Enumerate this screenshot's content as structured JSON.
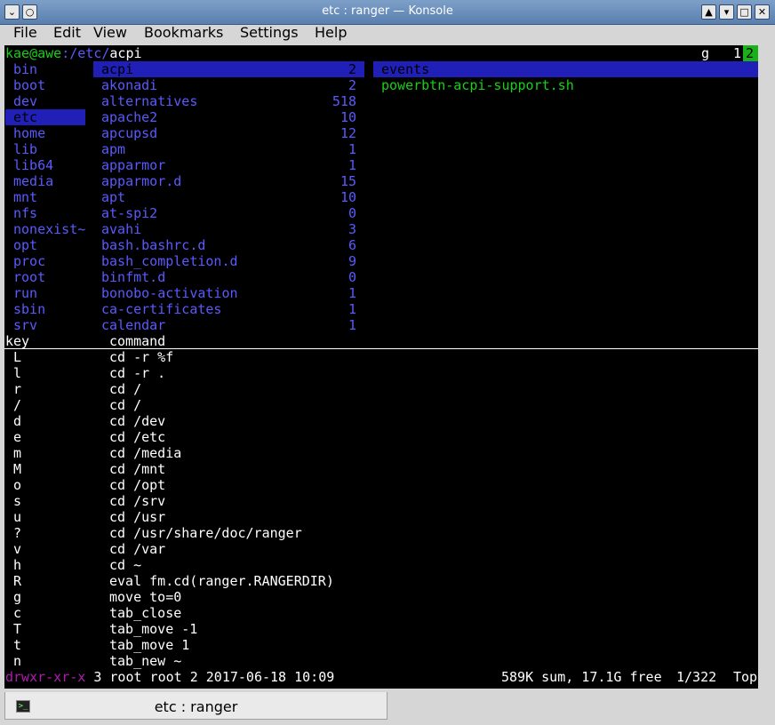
{
  "window": {
    "title": "etc : ranger — Konsole"
  },
  "menu": [
    "File",
    "Edit",
    "View",
    "Bookmarks",
    "Settings",
    "Help"
  ],
  "prompt": {
    "user_host": "kae@awe",
    "path": ":/etc/",
    "current": "acpi"
  },
  "tabs_indicator": {
    "key": "g",
    "tab1": "1",
    "tab2": "2"
  },
  "column_left": [
    "bin",
    "boot",
    "dev",
    "etc",
    "home",
    "lib",
    "lib64",
    "media",
    "mnt",
    "nfs",
    "nonexist~",
    "opt",
    "proc",
    "root",
    "run",
    "sbin",
    "srv"
  ],
  "column_mid": [
    {
      "name": "acpi",
      "count": "2"
    },
    {
      "name": "akonadi",
      "count": "2"
    },
    {
      "name": "alternatives",
      "count": "518"
    },
    {
      "name": "apache2",
      "count": "10"
    },
    {
      "name": "apcupsd",
      "count": "12"
    },
    {
      "name": "apm",
      "count": "1"
    },
    {
      "name": "apparmor",
      "count": "1"
    },
    {
      "name": "apparmor.d",
      "count": "15"
    },
    {
      "name": "apt",
      "count": "10"
    },
    {
      "name": "at-spi2",
      "count": "0"
    },
    {
      "name": "avahi",
      "count": "3"
    },
    {
      "name": "bash.bashrc.d",
      "count": "6"
    },
    {
      "name": "bash_completion.d",
      "count": "9"
    },
    {
      "name": "binfmt.d",
      "count": "0"
    },
    {
      "name": "bonobo-activation",
      "count": "1"
    },
    {
      "name": "ca-certificates",
      "count": "1"
    },
    {
      "name": "calendar",
      "count": "1"
    }
  ],
  "column_right": [
    "events",
    "powerbtn-acpi-support.sh"
  ],
  "keys_header": {
    "key": "key",
    "command": "command"
  },
  "keybindings": [
    {
      "key": "L",
      "cmd": "cd -r %f"
    },
    {
      "key": "l",
      "cmd": "cd -r ."
    },
    {
      "key": "r",
      "cmd": "cd /"
    },
    {
      "key": "/",
      "cmd": "cd /"
    },
    {
      "key": "d",
      "cmd": "cd /dev"
    },
    {
      "key": "e",
      "cmd": "cd /etc"
    },
    {
      "key": "m",
      "cmd": "cd /media"
    },
    {
      "key": "M",
      "cmd": "cd /mnt"
    },
    {
      "key": "o",
      "cmd": "cd /opt"
    },
    {
      "key": "s",
      "cmd": "cd /srv"
    },
    {
      "key": "u",
      "cmd": "cd /usr"
    },
    {
      "key": "?",
      "cmd": "cd /usr/share/doc/ranger"
    },
    {
      "key": "v",
      "cmd": "cd /var"
    },
    {
      "key": "h",
      "cmd": "cd ~"
    },
    {
      "key": "R",
      "cmd": "eval fm.cd(ranger.RANGERDIR)"
    },
    {
      "key": "g",
      "cmd": "move to=0"
    },
    {
      "key": "c",
      "cmd": "tab_close"
    },
    {
      "key": "T",
      "cmd": "tab_move -1"
    },
    {
      "key": "t",
      "cmd": "tab_move 1"
    },
    {
      "key": "n",
      "cmd": "tab_new ~"
    }
  ],
  "status": {
    "perms": "drwxr-xr-x",
    "info": "3 root root 2 2017-06-18 10:09",
    "summary": "589K sum, 17.1G free",
    "position": "1/322",
    "scroll": "Top"
  },
  "session_tab": {
    "label": "etc : ranger"
  },
  "colors": {
    "terminal_bg": "#000000",
    "dir_blue": "#5a5aff",
    "file_green": "#18d018",
    "selection": "#2020b8"
  }
}
